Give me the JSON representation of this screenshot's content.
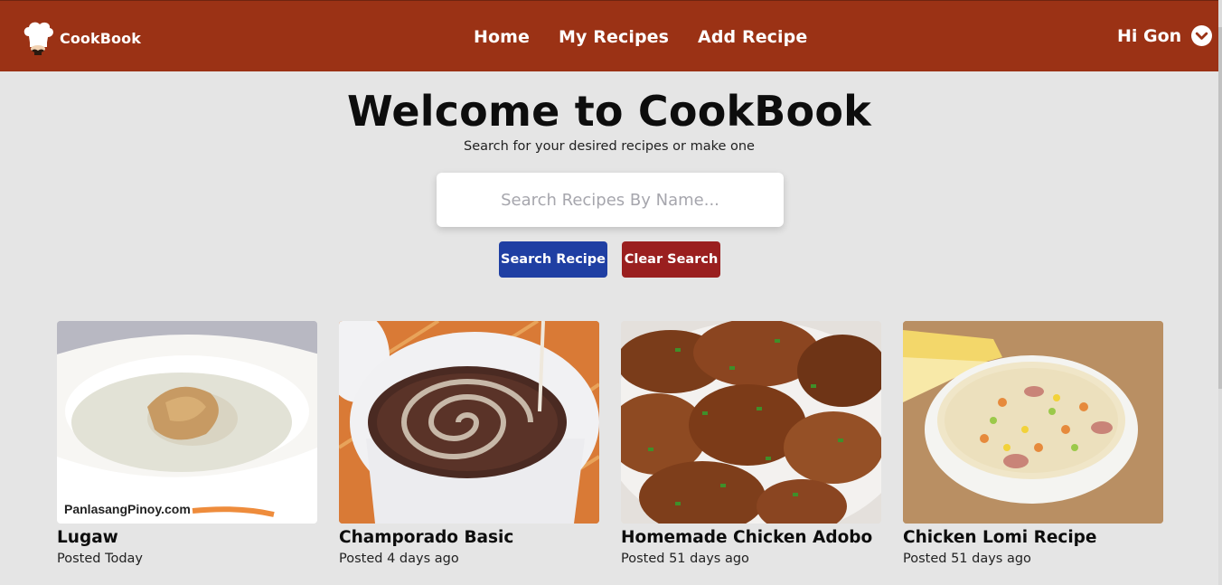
{
  "brand": {
    "name": "CookBook",
    "logo_icon": "chef-hat-icon"
  },
  "nav": {
    "links": [
      "Home",
      "My Recipes",
      "Add Recipe"
    ]
  },
  "user": {
    "greeting": "Hi Gon",
    "menu_icon": "chevron-down-icon"
  },
  "hero": {
    "title": "Welcome to CookBook",
    "subtitle": "Search for your desired recipes or make one"
  },
  "search": {
    "placeholder": "Search Recipes By Name...",
    "value": "",
    "search_label": "Search Recipe",
    "clear_label": "Clear Search"
  },
  "recipes": [
    {
      "title": "Lugaw",
      "posted": "Posted Today",
      "image_watermark": "PanlasangPinoy.com"
    },
    {
      "title": "Champorado Basic",
      "posted": "Posted 4 days ago"
    },
    {
      "title": "Homemade Chicken Adobo",
      "posted": "Posted 51 days ago"
    },
    {
      "title": "Chicken Lomi Recipe",
      "posted": "Posted 51 days ago"
    }
  ],
  "colors": {
    "navbar": "#9b3215",
    "search_button": "#1f3fa3",
    "clear_button": "#9a1f1f",
    "background": "#e5e5e5"
  }
}
